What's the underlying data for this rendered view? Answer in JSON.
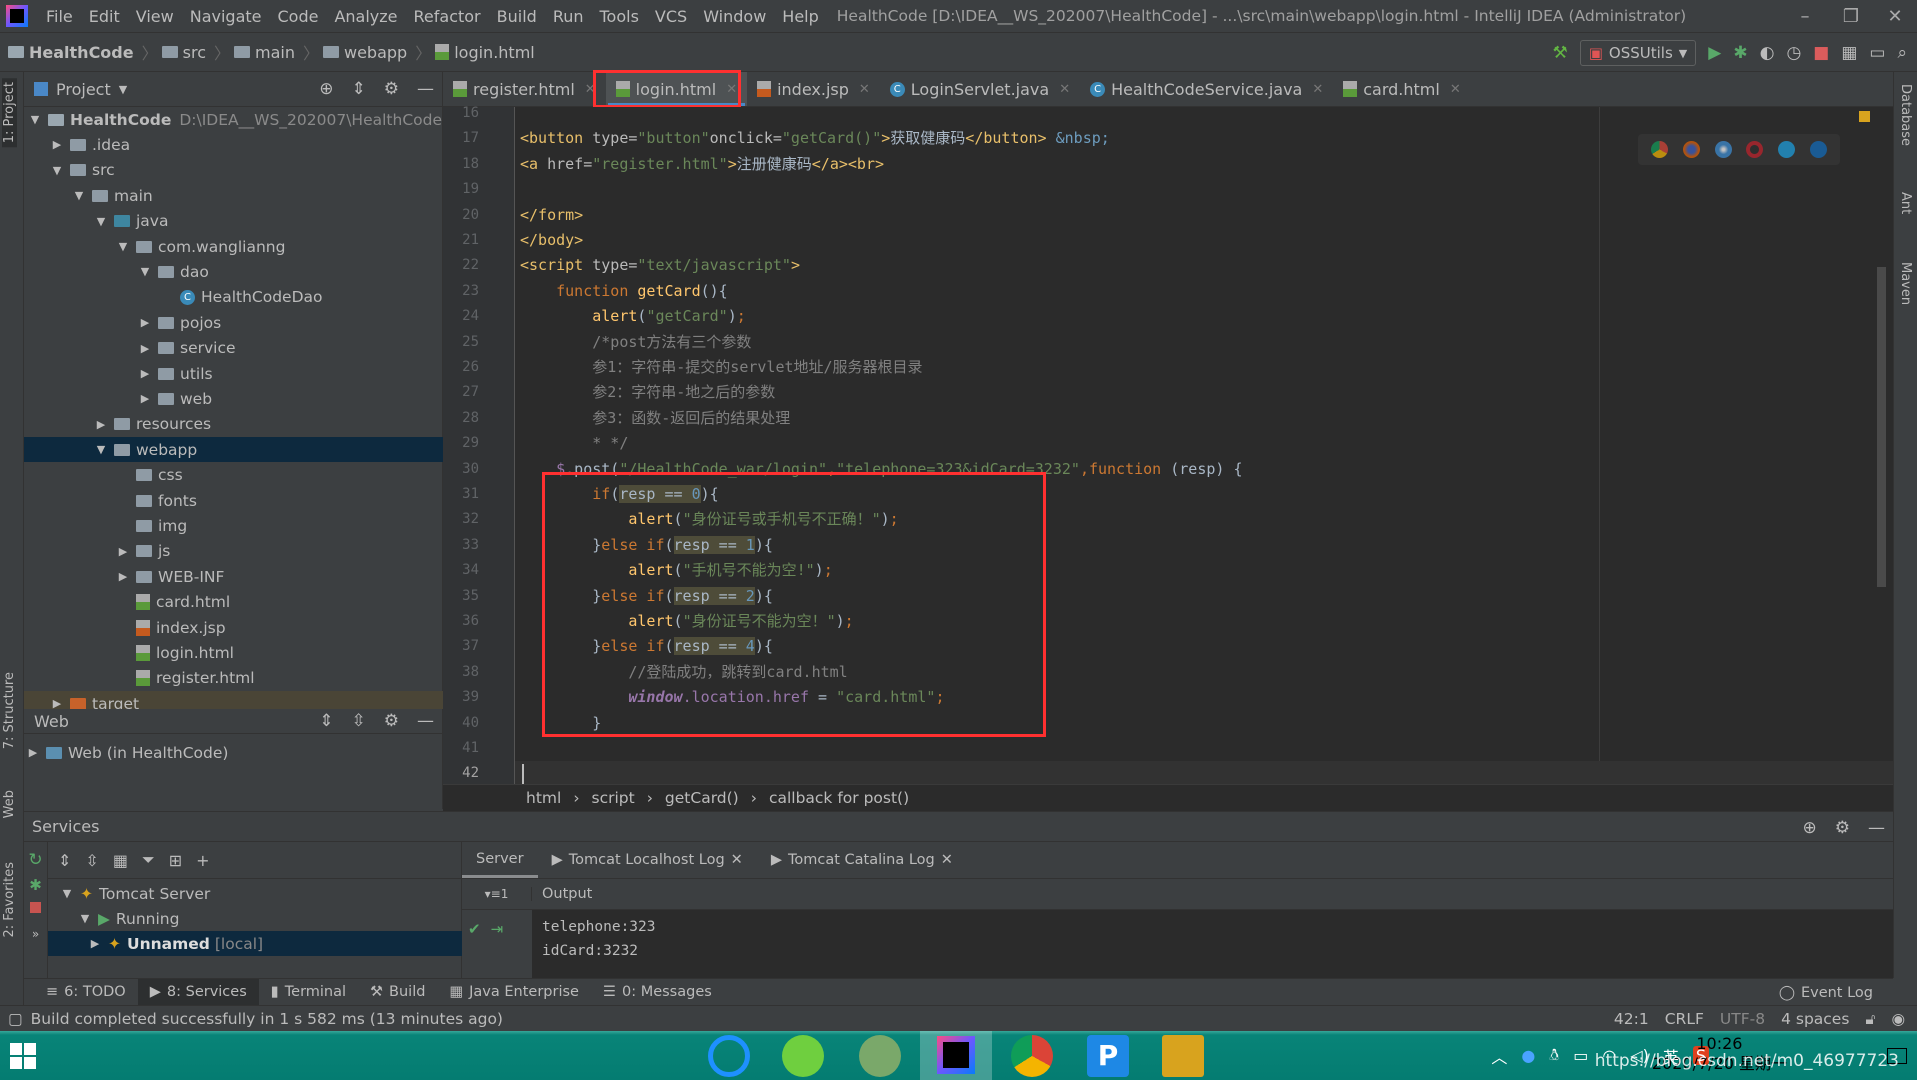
{
  "menubar": {
    "items": [
      "File",
      "Edit",
      "View",
      "Navigate",
      "Code",
      "Analyze",
      "Refactor",
      "Build",
      "Run",
      "Tools",
      "VCS",
      "Window",
      "Help"
    ],
    "title": "HealthCode [D:\\IDEA__WS_202007\\HealthCode] - ...\\src\\main\\webapp\\login.html - IntelliJ IDEA (Administrator)"
  },
  "navbar": {
    "crumbs": [
      "HealthCode",
      "src",
      "main",
      "webapp",
      "login.html"
    ],
    "run_config": "OSSUtils"
  },
  "left_strip": {
    "project": "1: Project",
    "structure": "7: Structure",
    "web": "Web",
    "favorites": "2: Favorites"
  },
  "right_strip": {
    "database": "Database",
    "ant": "Ant",
    "maven": "Maven"
  },
  "project": {
    "title": "Project",
    "tree": [
      {
        "label": "HealthCode",
        "hint": "D:\\IDEA__WS_202007\\HealthCode",
        "depth": 0,
        "exp": "open",
        "icon": "module",
        "bold": true
      },
      {
        "label": ".idea",
        "depth": 1,
        "exp": "closed",
        "icon": "folder"
      },
      {
        "label": "src",
        "depth": 1,
        "exp": "open",
        "icon": "folder"
      },
      {
        "label": "main",
        "depth": 2,
        "exp": "open",
        "icon": "folder"
      },
      {
        "label": "java",
        "depth": 3,
        "exp": "open",
        "icon": "source-folder"
      },
      {
        "label": "com.wanglianng",
        "depth": 4,
        "exp": "open",
        "icon": "package"
      },
      {
        "label": "dao",
        "depth": 5,
        "exp": "open",
        "icon": "package"
      },
      {
        "label": "HealthCodeDao",
        "depth": 6,
        "exp": "",
        "icon": "class"
      },
      {
        "label": "pojos",
        "depth": 5,
        "exp": "closed",
        "icon": "package"
      },
      {
        "label": "service",
        "depth": 5,
        "exp": "closed",
        "icon": "package"
      },
      {
        "label": "utils",
        "depth": 5,
        "exp": "closed",
        "icon": "package"
      },
      {
        "label": "web",
        "depth": 5,
        "exp": "closed",
        "icon": "package"
      },
      {
        "label": "resources",
        "depth": 3,
        "exp": "closed",
        "icon": "resources-folder"
      },
      {
        "label": "webapp",
        "depth": 3,
        "exp": "open",
        "icon": "web-folder",
        "selected": true
      },
      {
        "label": "css",
        "depth": 4,
        "exp": "",
        "icon": "folder"
      },
      {
        "label": "fonts",
        "depth": 4,
        "exp": "",
        "icon": "folder"
      },
      {
        "label": "img",
        "depth": 4,
        "exp": "",
        "icon": "folder"
      },
      {
        "label": "js",
        "depth": 4,
        "exp": "closed",
        "icon": "folder"
      },
      {
        "label": "WEB-INF",
        "depth": 4,
        "exp": "closed",
        "icon": "folder"
      },
      {
        "label": "card.html",
        "depth": 4,
        "exp": "",
        "icon": "html"
      },
      {
        "label": "index.jsp",
        "depth": 4,
        "exp": "",
        "icon": "jsp"
      },
      {
        "label": "login.html",
        "depth": 4,
        "exp": "",
        "icon": "html"
      },
      {
        "label": "register.html",
        "depth": 4,
        "exp": "",
        "icon": "html"
      },
      {
        "label": "target",
        "depth": 1,
        "exp": "closed",
        "icon": "excluded-folder",
        "target": true
      }
    ]
  },
  "web_panel": {
    "title": "Web",
    "item": "Web (in HealthCode)"
  },
  "tabs": [
    {
      "label": "register.html",
      "icon": "html"
    },
    {
      "label": "login.html",
      "icon": "html",
      "active": true
    },
    {
      "label": "index.jsp",
      "icon": "jsp"
    },
    {
      "label": "LoginServlet.java",
      "icon": "class"
    },
    {
      "label": "HealthCodeService.java",
      "icon": "class"
    },
    {
      "label": "card.html",
      "icon": "html"
    }
  ],
  "editor": {
    "first_line": 16,
    "current_line": 42,
    "lines": [
      [],
      [
        [
          "<button",
          "tag"
        ],
        [
          " type=",
          "attr"
        ],
        [
          "\"button\"",
          "str"
        ],
        [
          "onclick=",
          "attr"
        ],
        [
          "\"getCard()\"",
          "str"
        ],
        [
          ">",
          "tag"
        ],
        [
          "获取健康码",
          "text"
        ],
        [
          "</button>",
          "tag"
        ],
        [
          " &nbsp;",
          "ent"
        ]
      ],
      [
        [
          "<a",
          "tag"
        ],
        [
          " href=",
          "attr"
        ],
        [
          "\"register.html\"",
          "str"
        ],
        [
          ">",
          "tag"
        ],
        [
          "注册健康码",
          "text"
        ],
        [
          "</a><br>",
          "tag"
        ]
      ],
      [],
      [
        [
          "</form>",
          "tag"
        ]
      ],
      [
        [
          "</body>",
          "tag"
        ]
      ],
      [
        [
          "<script",
          "tag"
        ],
        [
          " type=",
          "attr"
        ],
        [
          "\"text/javascript\"",
          "str"
        ],
        [
          ">",
          "tag"
        ]
      ],
      [
        [
          "    ",
          "text"
        ],
        [
          "function",
          "kw"
        ],
        [
          " ",
          "text"
        ],
        [
          "getCard",
          "fn"
        ],
        [
          "(){",
          "text"
        ]
      ],
      [
        [
          "        ",
          "text"
        ],
        [
          "alert",
          "fn"
        ],
        [
          "(",
          "text"
        ],
        [
          "\"getCard\"",
          "str"
        ],
        [
          ")",
          "text"
        ],
        [
          ";",
          "kw"
        ]
      ],
      [
        [
          "        /*post方法有三个参数",
          "cm"
        ]
      ],
      [
        [
          "        参1：字符串-提交的servlet地址/服务器根目录",
          "cm"
        ]
      ],
      [
        [
          "        参2：字符串-地之后的参数",
          "cm"
        ]
      ],
      [
        [
          "        参3：函数-返回后的结果处理",
          "cm"
        ]
      ],
      [
        [
          "        * */",
          "cm"
        ]
      ],
      [
        [
          "    ",
          "text"
        ],
        [
          "$",
          "dl"
        ],
        [
          ".post(",
          "text"
        ],
        [
          "\"/HealthCode_war/login\"",
          "str"
        ],
        [
          ",",
          "kw"
        ],
        [
          "\"telephone=323&idCard=3232\"",
          "str"
        ],
        [
          ",",
          "kw"
        ],
        [
          "function",
          "kw"
        ],
        [
          " (resp) {",
          "text"
        ]
      ],
      [
        [
          "        ",
          "text"
        ],
        [
          "if",
          "kw"
        ],
        [
          "(",
          "text"
        ],
        [
          "resp == ",
          "hl"
        ],
        [
          "0",
          "hlnum"
        ],
        [
          "){",
          "text"
        ]
      ],
      [
        [
          "            ",
          "text"
        ],
        [
          "alert",
          "fn"
        ],
        [
          "(",
          "text"
        ],
        [
          "\"身份证号或手机号不正确！\"",
          "str"
        ],
        [
          ")",
          "text"
        ],
        [
          ";",
          "kw"
        ]
      ],
      [
        [
          "        }",
          "text"
        ],
        [
          "else if",
          "kw"
        ],
        [
          "(",
          "text"
        ],
        [
          "resp == ",
          "hl"
        ],
        [
          "1",
          "hlnum"
        ],
        [
          "){",
          "text"
        ]
      ],
      [
        [
          "            ",
          "text"
        ],
        [
          "alert",
          "fn"
        ],
        [
          "(",
          "text"
        ],
        [
          "\"手机号不能为空!\"",
          "str"
        ],
        [
          ")",
          "text"
        ],
        [
          ";",
          "kw"
        ]
      ],
      [
        [
          "        }",
          "text"
        ],
        [
          "else if",
          "kw"
        ],
        [
          "(",
          "text"
        ],
        [
          "resp == ",
          "hl"
        ],
        [
          "2",
          "hlnum"
        ],
        [
          "){",
          "text"
        ]
      ],
      [
        [
          "            ",
          "text"
        ],
        [
          "alert",
          "fn"
        ],
        [
          "(",
          "text"
        ],
        [
          "\"身份证号不能为空！\"",
          "str"
        ],
        [
          ")",
          "text"
        ],
        [
          ";",
          "kw"
        ]
      ],
      [
        [
          "        }",
          "text"
        ],
        [
          "else if",
          "kw"
        ],
        [
          "(",
          "text"
        ],
        [
          "resp == ",
          "hl"
        ],
        [
          "4",
          "hlnum"
        ],
        [
          "){",
          "text"
        ]
      ],
      [
        [
          "            //登陆成功，跳转到card.html",
          "cm"
        ]
      ],
      [
        [
          "            ",
          "text"
        ],
        [
          "window",
          "win"
        ],
        [
          ".location.href",
          "var"
        ],
        [
          " = ",
          "text"
        ],
        [
          "\"card.html\"",
          "str"
        ],
        [
          ";",
          "kw"
        ]
      ],
      [
        [
          "        }",
          "text"
        ]
      ],
      [],
      []
    ],
    "breadcrumbs": [
      "html",
      "script",
      "getCard()",
      "callback for post()"
    ],
    "browser_icons": [
      "chrome-icon",
      "firefox-icon",
      "safari-icon",
      "opera-icon",
      "ie-icon",
      "edge-icon"
    ]
  },
  "services": {
    "title": "Services",
    "tree": [
      {
        "label": "Tomcat Server"
      },
      {
        "label": "Running"
      },
      {
        "label": "Unnamed",
        "hint": "[local]"
      }
    ],
    "tabs": [
      "Server",
      "Tomcat Localhost Log",
      "Tomcat Catalina Log"
    ],
    "output_label": "Output",
    "output_lines": [
      "telephone:323",
      "idCard:3232"
    ]
  },
  "bottom_tabs": [
    "6: TODO",
    "8: Services",
    "Terminal",
    "Build",
    "Java Enterprise",
    "0: Messages"
  ],
  "event_log": "Event Log",
  "status": {
    "message": "Build completed successfully in 1 s 582 ms (13 minutes ago)",
    "position": "42:1",
    "line_sep": "CRLF",
    "encoding": "UTF-8",
    "indent": "4 spaces"
  },
  "taskbar": {
    "time": "10:26",
    "date": "2020/7/20 星期一",
    "ime": "英",
    "watermark": "https://blog.csdn.net/m0_46977723"
  },
  "colors": {
    "accent": "#4a88c7",
    "highlight_box": "#ff3030",
    "selection": "#0d293e",
    "editor_bg": "#2b2b2b"
  }
}
